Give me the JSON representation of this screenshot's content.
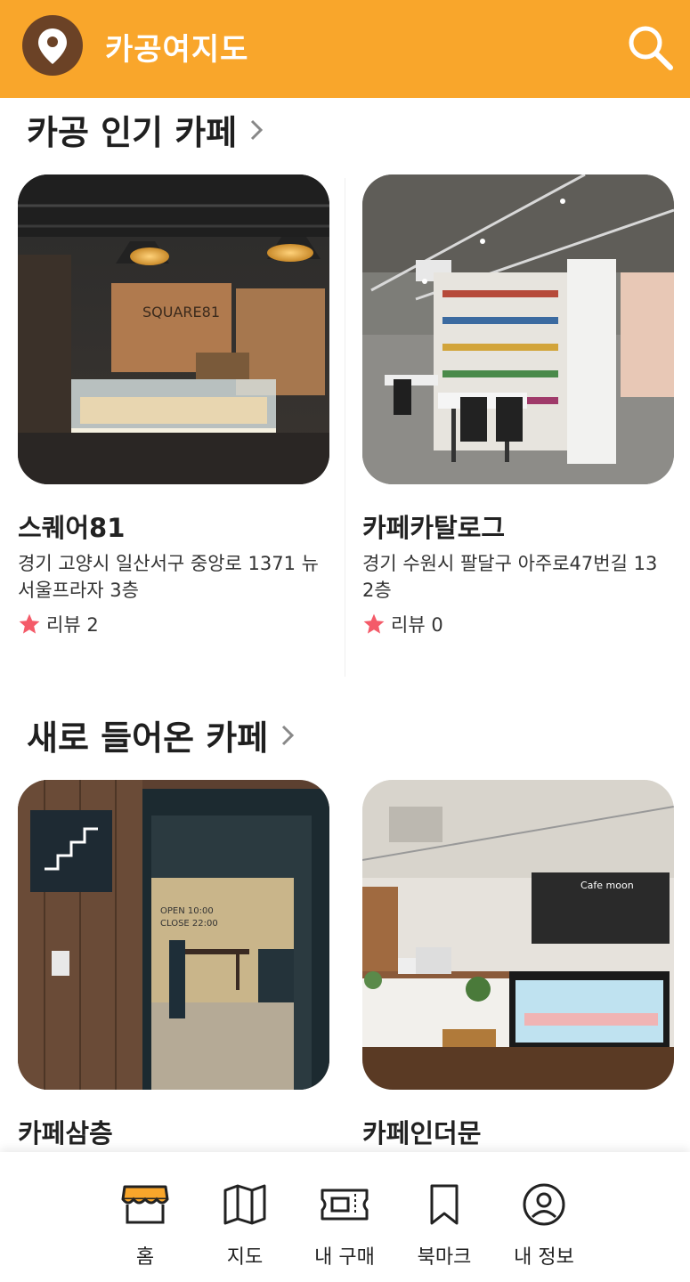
{
  "header": {
    "title": "카공여지도",
    "logo_icon": "location-pin-icon",
    "search_icon": "search-icon",
    "background_color": "#F9A62B",
    "logo_bg_color": "#6B4226"
  },
  "sections": [
    {
      "title": "카공 인기 카페",
      "cafes": [
        {
          "name": "스퀘어81",
          "address": "경기 고양시 일산서구 중앙로 1371 뉴서울프라자 3층",
          "review_label": "리뷰 2"
        },
        {
          "name": "카페카탈로그",
          "address": "경기 수원시 팔달구 아주로47번길 13 2층",
          "review_label": "리뷰 0"
        }
      ]
    },
    {
      "title": "새로 들어온 카페",
      "cafes": [
        {
          "name": "카페삼층"
        },
        {
          "name": "카페인더문"
        }
      ]
    }
  ],
  "bottom_nav": [
    {
      "label": "홈",
      "icon": "storefront-icon"
    },
    {
      "label": "지도",
      "icon": "map-icon"
    },
    {
      "label": "내 구매",
      "icon": "ticket-icon"
    },
    {
      "label": "북마크",
      "icon": "bookmark-icon"
    },
    {
      "label": "내 정보",
      "icon": "user-profile-icon"
    }
  ],
  "colors": {
    "accent": "#F9A62B",
    "star": "#F45B69"
  }
}
